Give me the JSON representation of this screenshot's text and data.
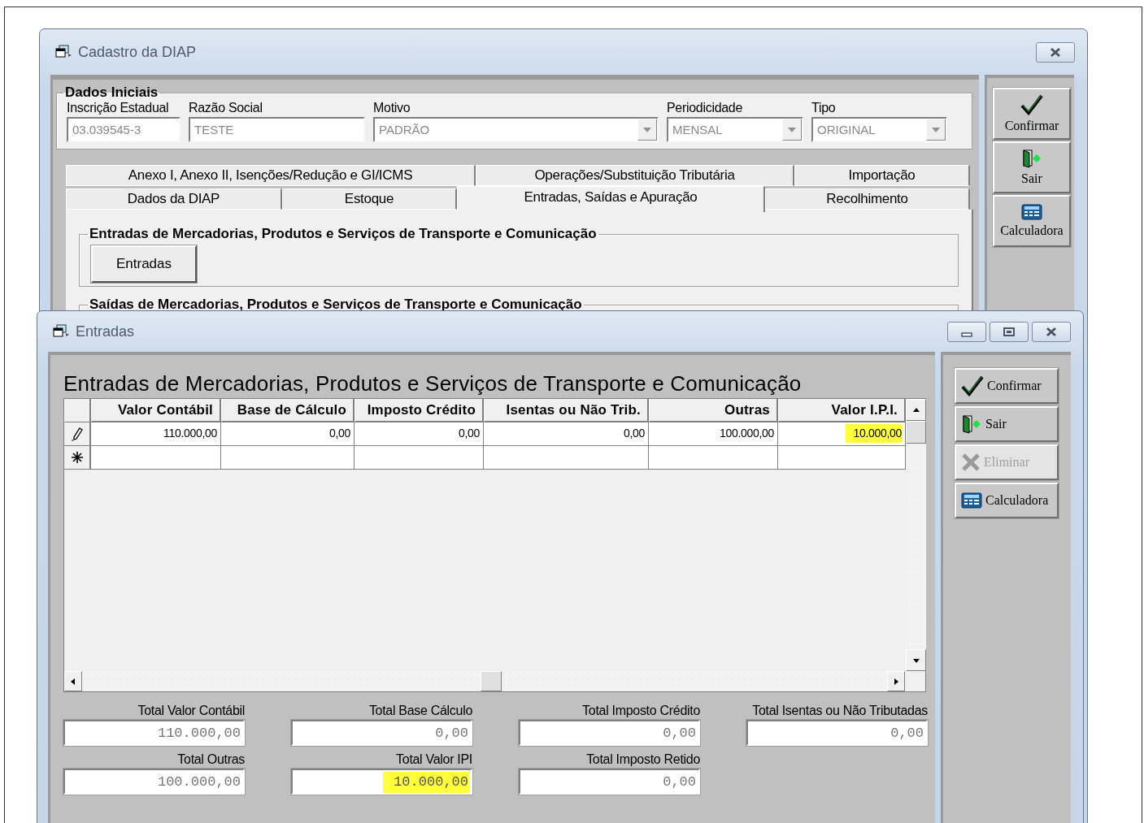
{
  "back_window": {
    "title": "Cadastro da DIAP",
    "group": {
      "title": "Dados Iniciais",
      "fields": [
        {
          "label": "Inscrição Estadual",
          "value": "03.039545-3",
          "kind": "text"
        },
        {
          "label": "Razão Social",
          "value": "TESTE",
          "kind": "text"
        },
        {
          "label": "Motivo",
          "value": "PADRÃO",
          "kind": "dropdown"
        },
        {
          "label": "Periodicidade",
          "value": "MENSAL",
          "kind": "dropdown"
        },
        {
          "label": "Tipo",
          "value": "ORIGINAL",
          "kind": "dropdown"
        }
      ]
    },
    "tab_rows": [
      [
        {
          "label": "Anexo I, Anexo II, Isenções/Redução e GI/ICMS",
          "selected": false
        },
        {
          "label": "Operações/Substituição Tributária",
          "selected": false
        },
        {
          "label": "Importação",
          "selected": false
        }
      ],
      [
        {
          "label": "Dados da DIAP",
          "selected": false
        },
        {
          "label": "Estoque",
          "selected": false
        },
        {
          "label": "Entradas, Saídas e Apuração",
          "selected": true
        },
        {
          "label": "Recolhimento",
          "selected": false
        }
      ]
    ],
    "sections": [
      {
        "title": "Entradas de Mercadorias, Produtos e Serviços de Transporte e Comunicação",
        "button": "Entradas"
      },
      {
        "title": "Saídas de Mercadorias, Produtos e Serviços de Transporte e Comunicação"
      }
    ],
    "buttons": [
      {
        "label": "Confirmar",
        "kind": "confirm"
      },
      {
        "label": "Sair",
        "kind": "exit"
      },
      {
        "label": "Calculadora",
        "kind": "calculator"
      }
    ]
  },
  "front_window": {
    "title": "Entradas",
    "heading": "Entradas de Mercadorias, Produtos e Serviços de Transporte e Comunicação",
    "table": {
      "columns": [
        "Valor Contábil",
        "Base de Cálculo",
        "Imposto Crédito",
        "Isentas ou Não Trib.",
        "Outras",
        "Valor I.P.I."
      ],
      "rows": [
        {
          "kind": "edit",
          "cells": [
            {
              "text": "110.000,00",
              "highlighted": false
            },
            {
              "text": "0,00",
              "highlighted": false
            },
            {
              "text": "0,00",
              "highlighted": false
            },
            {
              "text": "0,00",
              "highlighted": false
            },
            {
              "text": "100.000,00",
              "highlighted": false
            },
            {
              "text": "10.000,00",
              "highlighted": true
            }
          ]
        },
        {
          "kind": "new"
        }
      ]
    },
    "totals": [
      {
        "label": "Total Valor Contábil",
        "value": "110.000,00",
        "highlighted": false
      },
      {
        "label": "Total Base Cálculo",
        "value": "0,00",
        "highlighted": false
      },
      {
        "label": "Total Imposto Crédito",
        "value": "0,00",
        "highlighted": false
      },
      {
        "label": "Total Isentas ou Não Tributadas",
        "value": "0,00",
        "highlighted": false
      },
      {
        "label": "Total Outras",
        "value": "100.000,00",
        "highlighted": false
      },
      {
        "label": "Total Valor IPI",
        "value": "10.000,00",
        "highlighted": true
      },
      {
        "label": "Total Imposto Retido",
        "value": "0,00",
        "highlighted": false
      }
    ],
    "buttons": [
      {
        "label": "Confirmar",
        "kind": "confirm",
        "disabled": false
      },
      {
        "label": "Sair",
        "kind": "exit",
        "disabled": false
      },
      {
        "label": "Eliminar",
        "kind": "delete",
        "disabled": true
      },
      {
        "label": "Calculadora",
        "kind": "calculator",
        "disabled": false
      }
    ]
  }
}
